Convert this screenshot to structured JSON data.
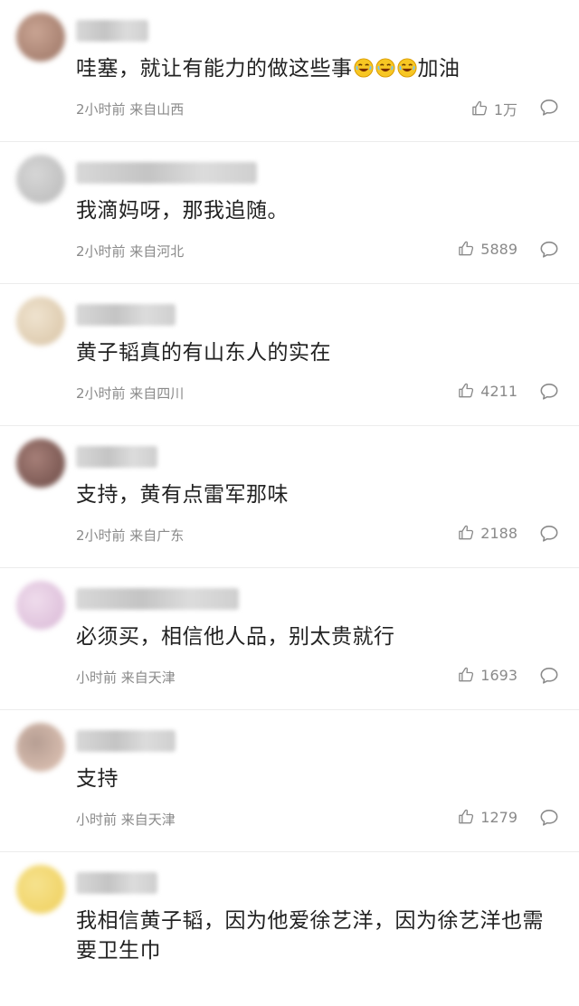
{
  "comments": [
    {
      "text_parts": [
        "哇塞，就让有能力的做这些事",
        "加油"
      ],
      "emoji_count": 3,
      "meta": "2小时前 来自山西",
      "likes": "1万",
      "avatar_colors": [
        "#9b7464",
        "#c9a493"
      ],
      "name_width": 80
    },
    {
      "text": "我滴妈呀，那我追随。",
      "meta": "2小时前 来自河北",
      "likes": "5889",
      "avatar_colors": [
        "#b9b9b9",
        "#d6d6d6"
      ],
      "name_width": 200
    },
    {
      "text": "黄子韬真的有山东人的实在",
      "meta": "2小时前 来自四川",
      "likes": "4211",
      "avatar_colors": [
        "#d8c3a4",
        "#efe3cf"
      ],
      "name_width": 110
    },
    {
      "text": "支持，黄有点雷军那味",
      "meta": "2小时前 来自广东",
      "likes": "2188",
      "avatar_colors": [
        "#6b4a45",
        "#a67f78"
      ],
      "name_width": 90
    },
    {
      "text": "必须买，相信他人品，别太贵就行",
      "meta": "小时前 来自天津",
      "likes": "1693",
      "avatar_colors": [
        "#d9b8d6",
        "#efdcec"
      ],
      "name_width": 180
    },
    {
      "text": "支持",
      "meta": "小时前 来自天津",
      "likes": "1279",
      "avatar_colors": [
        "#e3c7b8",
        "#b69e93"
      ],
      "name_width": 110
    },
    {
      "text": "我相信黄子韬，因为他爱徐艺洋，因为徐艺洋也需要卫生巾",
      "meta": "",
      "likes": "",
      "avatar_colors": [
        "#efcf5b",
        "#f6e28e"
      ],
      "name_width": 90
    }
  ]
}
